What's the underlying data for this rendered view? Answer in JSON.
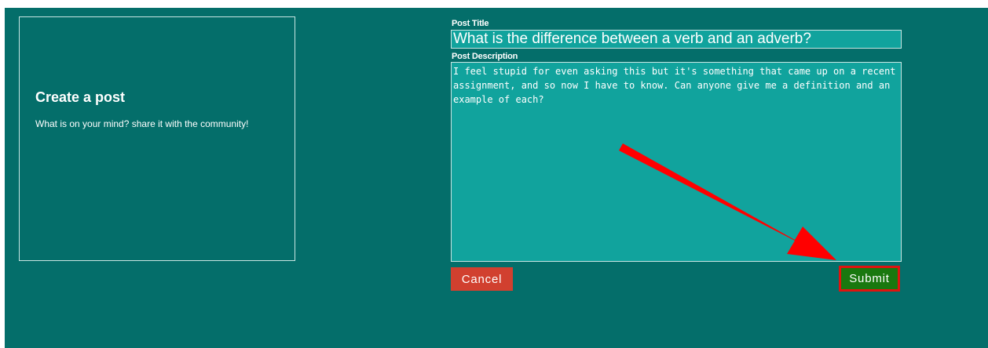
{
  "sidebar": {
    "title": "Create a post",
    "subtitle": "What is on your mind? share it with the community!"
  },
  "form": {
    "title_label": "Post Title",
    "title_value": "What is the difference between a verb and an adverb?",
    "description_label": "Post Description",
    "description_value": "I feel stupid for even asking this but it's something that came up on a recent assignment, and so now I have to know. Can anyone give me a definition and an example of each?",
    "cancel_label": "Cancel",
    "submit_label": "Submit"
  },
  "colors": {
    "background": "#046e6a",
    "field": "#11a39d",
    "cancel": "#d1402f",
    "submit": "#19780f",
    "highlight": "#e0130f"
  },
  "annotation": {
    "icon": "red-arrow-icon"
  }
}
